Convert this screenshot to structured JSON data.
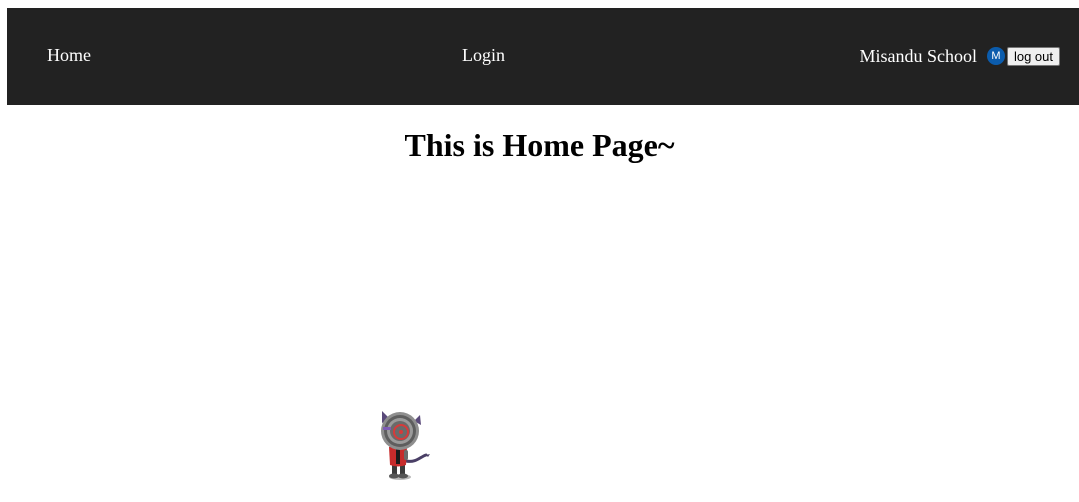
{
  "navbar": {
    "home_label": "Home",
    "login_label": "Login",
    "school_name": "Misandu School",
    "avatar_letter": "M",
    "logout_label": "log out",
    "background_color": "#222222",
    "avatar_color": "#0b5cad"
  },
  "main": {
    "title": "This is Home Page~"
  },
  "mascot": {
    "icon": "robot-mascot-icon"
  }
}
